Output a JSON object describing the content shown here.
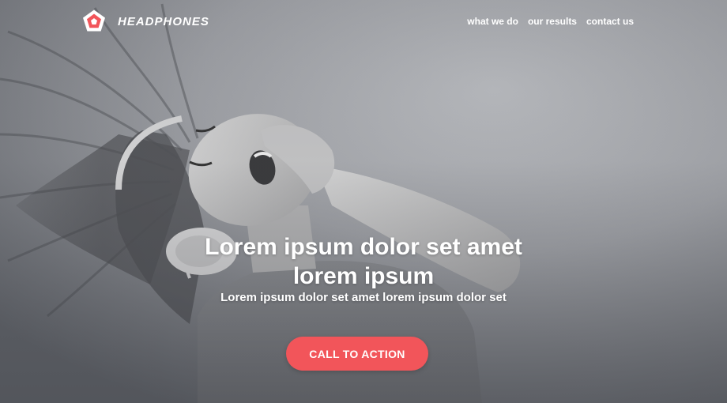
{
  "brand": {
    "name": "HEADPHONES",
    "logo_icon": "pentagon-logo-icon"
  },
  "nav": {
    "links": [
      "what we do",
      "our results",
      "contact us"
    ]
  },
  "hero": {
    "headline_line1": "Lorem ipsum dolor set amet",
    "headline_line2": "lorem ipsum",
    "subhead": "Lorem ipsum dolor set amet lorem ipsum dolor set",
    "cta_label": "CALL TO ACTION",
    "image": "woman-with-headphones-photo"
  },
  "colors": {
    "accent": "#f2555a",
    "text": "#ffffff",
    "background": "#9fa1a6"
  }
}
